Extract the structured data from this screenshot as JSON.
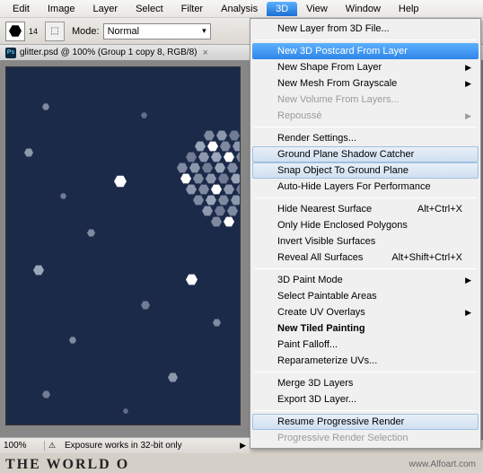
{
  "menubar": {
    "items": [
      "Edit",
      "Image",
      "Layer",
      "Select",
      "Filter",
      "Analysis",
      "3D",
      "View",
      "Window",
      "Help"
    ],
    "open_index": 6
  },
  "toolbar": {
    "brush_number": "14",
    "tool_button": "⬚",
    "mode_label": "Mode:",
    "mode_value": "Normal"
  },
  "document": {
    "title": "glitter.psd @ 100% (Group 1 copy 8, RGB/8)",
    "ps_label": "Ps"
  },
  "statusbar": {
    "zoom": "100%",
    "text": "Exposure works in 32-bit only"
  },
  "watermark": "www.Alfoart.com",
  "bottom_text": "THE WORLD O",
  "dropdown": {
    "groups": [
      [
        {
          "label": "New Layer from 3D File...",
          "type": "normal"
        }
      ],
      [
        {
          "label": "New 3D Postcard From Layer",
          "type": "highlighted"
        },
        {
          "label": "New Shape From Layer",
          "type": "submenu"
        },
        {
          "label": "New Mesh From Grayscale",
          "type": "submenu"
        },
        {
          "label": "New Volume From Layers...",
          "type": "disabled"
        },
        {
          "label": "Repoussé",
          "type": "submenu-disabled"
        }
      ],
      [
        {
          "label": "Render Settings...",
          "type": "normal"
        },
        {
          "label": "Ground Plane Shadow Catcher",
          "type": "toggled"
        },
        {
          "label": "Snap Object To Ground Plane",
          "type": "toggled"
        },
        {
          "label": "Auto-Hide Layers For Performance",
          "type": "normal"
        }
      ],
      [
        {
          "label": "Hide Nearest Surface",
          "type": "normal",
          "shortcut": "Alt+Ctrl+X"
        },
        {
          "label": "Only Hide Enclosed Polygons",
          "type": "normal"
        },
        {
          "label": "Invert Visible Surfaces",
          "type": "normal"
        },
        {
          "label": "Reveal All Surfaces",
          "type": "normal",
          "shortcut": "Alt+Shift+Ctrl+X"
        }
      ],
      [
        {
          "label": "3D Paint Mode",
          "type": "submenu"
        },
        {
          "label": "Select Paintable Areas",
          "type": "normal"
        },
        {
          "label": "Create UV Overlays",
          "type": "submenu"
        },
        {
          "label": "New Tiled Painting",
          "type": "bold"
        },
        {
          "label": "Paint Falloff...",
          "type": "normal"
        },
        {
          "label": "Reparameterize UVs...",
          "type": "normal"
        }
      ],
      [
        {
          "label": "Merge 3D Layers",
          "type": "normal"
        },
        {
          "label": "Export 3D Layer...",
          "type": "normal"
        }
      ],
      [
        {
          "label": "Resume Progressive Render",
          "type": "toggled"
        },
        {
          "label": "Progressive Render Selection",
          "type": "disabled"
        }
      ]
    ]
  }
}
